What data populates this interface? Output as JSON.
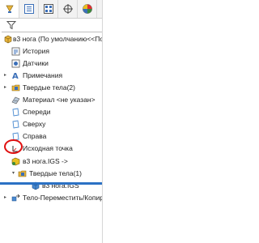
{
  "tabs": [
    {
      "name": "featuremanager-tab",
      "icon": "featuremanager-icon",
      "active": true
    },
    {
      "name": "propertymanager-tab",
      "icon": "propertymanager-icon",
      "active": false
    },
    {
      "name": "configurationmanager-tab",
      "icon": "configurationmanager-icon",
      "active": false
    },
    {
      "name": "dimxpert-tab",
      "icon": "dimxpert-icon",
      "active": false
    },
    {
      "name": "displaymanager-tab",
      "icon": "displaymanager-icon",
      "active": false
    }
  ],
  "filter": {
    "icon": "filter-icon"
  },
  "tree": {
    "root": "в3 нога  (По умолчанию<<По",
    "history": "История",
    "sensors": "Датчики",
    "notes": "Примечания",
    "solid_bodies": "Твердые тела(2)",
    "material": "Материал <не указан>",
    "front": "Спереди",
    "top": "Сверху",
    "right": "Справа",
    "origin": "Исходная точка",
    "imported_feature": "в3 нога.IGS ->",
    "imported_solid_bodies": "Твердые тела(1)",
    "imported_body": "в3 нога.IGS",
    "move_feature": "Тело-Переместить/Копиров"
  },
  "colors": {
    "accent": "#2b71c4",
    "annotation": "#e01010",
    "folder": "#e8b43a",
    "plane": "#4a8ad0"
  }
}
